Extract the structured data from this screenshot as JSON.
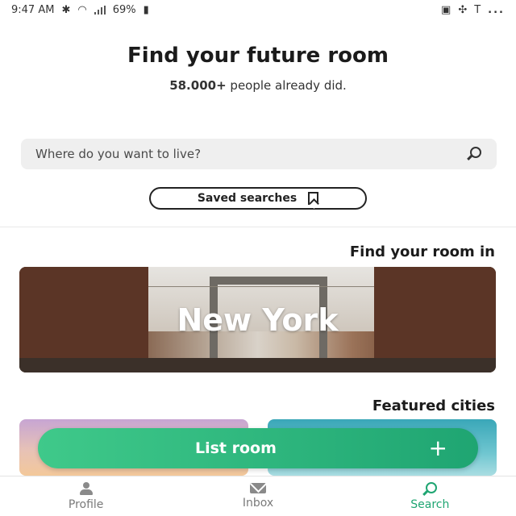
{
  "status_bar": {
    "time": "9:47 AM",
    "battery": "69%",
    "right_icons": [
      "T",
      "pinwheel-icon",
      "image-icon"
    ],
    "menu": "..."
  },
  "hero": {
    "title": "Find your future room",
    "count": "58.000+",
    "subtitle_rest": "people already did."
  },
  "search": {
    "placeholder": "Where do you want to live?"
  },
  "saved_searches": {
    "label": "Saved searches"
  },
  "find_room": {
    "title": "Find your room in",
    "city": "New York"
  },
  "featured": {
    "title": "Featured cities"
  },
  "list_room": {
    "label": "List room",
    "plus": "+"
  },
  "tabs": [
    {
      "label": "Search",
      "icon": "search-icon",
      "active": true
    },
    {
      "label": "Inbox",
      "icon": "mail-icon",
      "active": false
    },
    {
      "label": "Profile",
      "icon": "person-icon",
      "active": false
    }
  ],
  "colors": {
    "accent": "#1fa572",
    "fab_start": "#3fc98a"
  }
}
